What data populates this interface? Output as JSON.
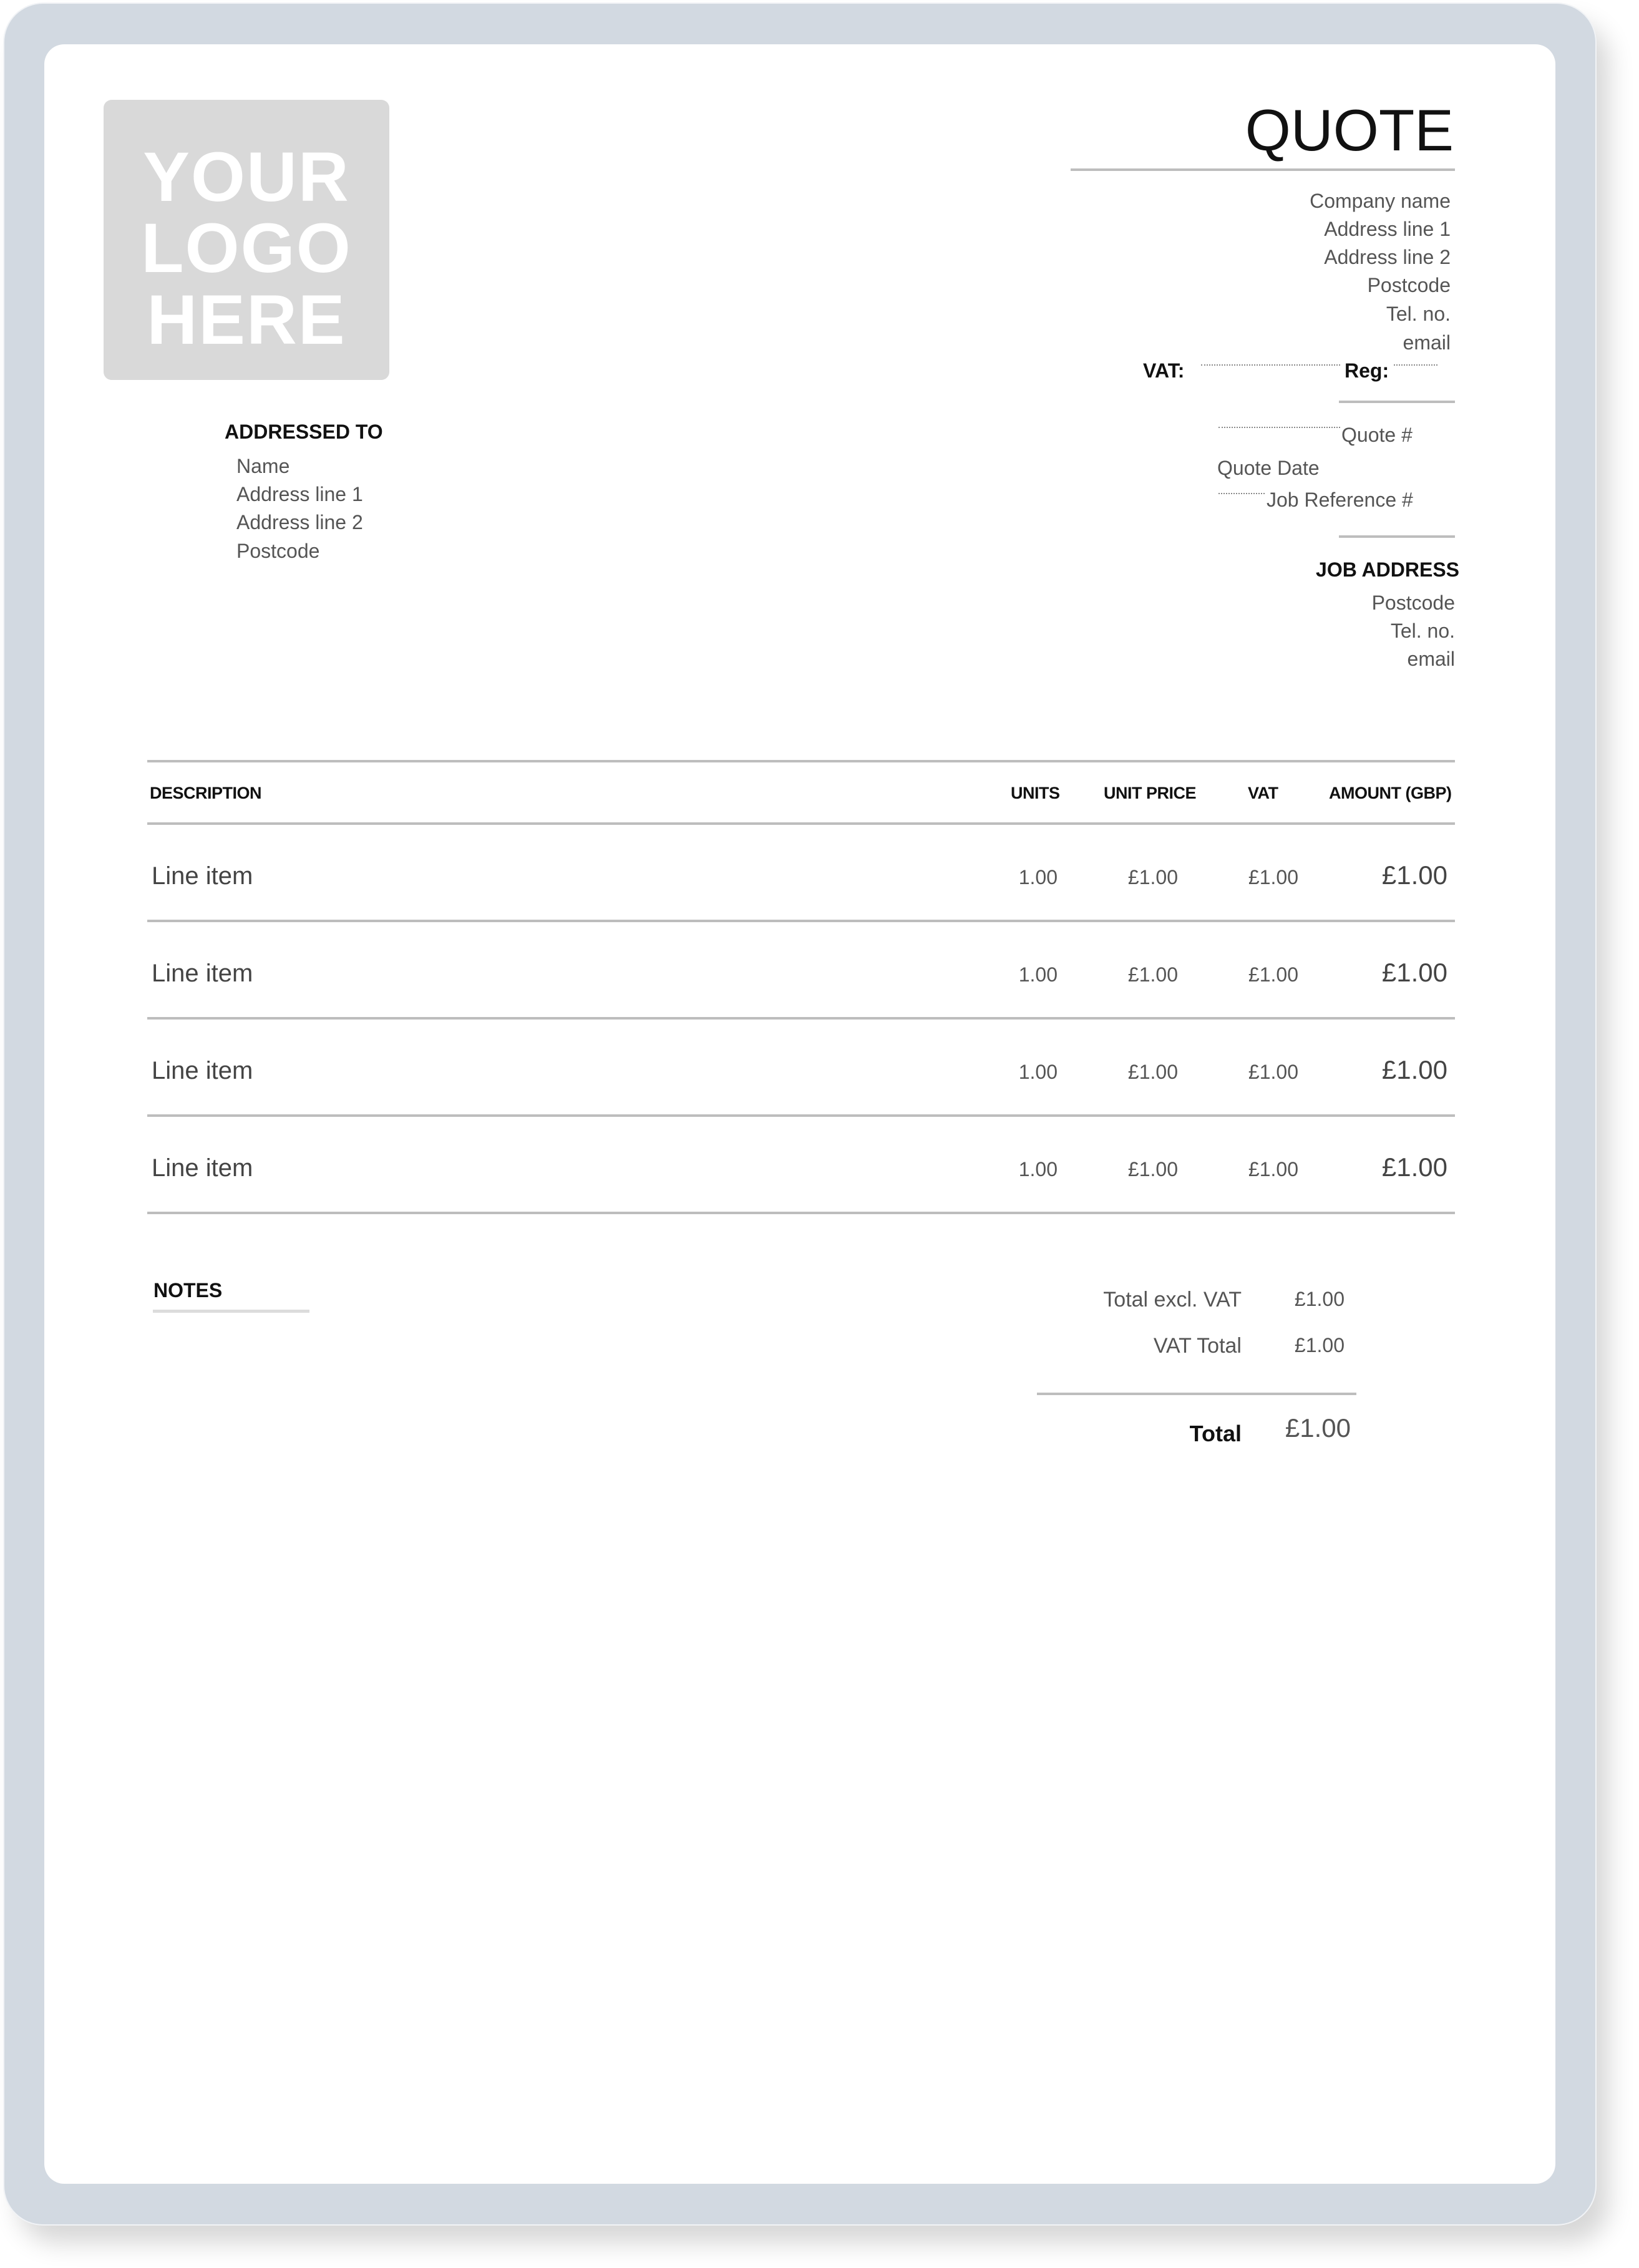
{
  "logo": {
    "lines": [
      "YOUR",
      "LOGO",
      "HERE"
    ]
  },
  "document": {
    "title": "QUOTE"
  },
  "company": {
    "name": "Company name",
    "address_line_1": "Address line 1",
    "address_line_2": "Address line 2",
    "postcode": "Postcode",
    "tel": "Tel. no.",
    "email": "email",
    "vat_label": "VAT:",
    "reg_label": "Reg:"
  },
  "quote_meta": {
    "quote_number_label": "Quote #",
    "quote_date_label": "Quote Date",
    "job_reference_label": "Job Reference #"
  },
  "addressed_to": {
    "heading": "ADDRESSED TO",
    "name": "Name",
    "address_line_1": "Address line 1",
    "address_line_2": "Address line 2",
    "postcode": "Postcode"
  },
  "job_address": {
    "heading": "JOB ADDRESS",
    "postcode": "Postcode",
    "tel": "Tel. no.",
    "email": "email"
  },
  "table": {
    "headers": {
      "description": "DESCRIPTION",
      "units": "UNITS",
      "unit_price": "UNIT PRICE",
      "vat": "VAT",
      "amount": "AMOUNT (GBP)"
    },
    "rows": [
      {
        "description": "Line item",
        "units": "1.00",
        "unit_price": "£1.00",
        "vat": "£1.00",
        "amount": "£1.00"
      },
      {
        "description": "Line item",
        "units": "1.00",
        "unit_price": "£1.00",
        "vat": "£1.00",
        "amount": "£1.00"
      },
      {
        "description": "Line item",
        "units": "1.00",
        "unit_price": "£1.00",
        "vat": "£1.00",
        "amount": "£1.00"
      },
      {
        "description": "Line item",
        "units": "1.00",
        "unit_price": "£1.00",
        "vat": "£1.00",
        "amount": "£1.00"
      }
    ]
  },
  "notes": {
    "heading": "NOTES"
  },
  "totals": {
    "excl_vat_label": "Total excl. VAT",
    "excl_vat_value": "£1.00",
    "vat_total_label": "VAT Total",
    "vat_total_value": "£1.00",
    "total_label": "Total",
    "total_value": "£1.00"
  }
}
